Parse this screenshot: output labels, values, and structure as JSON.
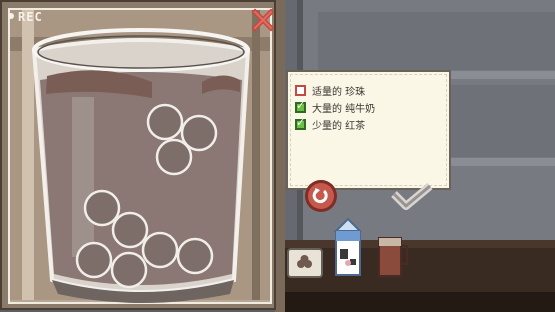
{
  "hud": {
    "rec_label": "REC"
  },
  "recipe": {
    "items": [
      {
        "text": "适量的 珍珠",
        "checked": false
      },
      {
        "text": "大量的 纯牛奶",
        "checked": true
      },
      {
        "text": "少量的 红茶",
        "checked": true
      }
    ]
  },
  "colors": {
    "accent_red": "#c14b42",
    "check_green": "#6bbf45",
    "tea_color": "#8b6f68",
    "pearl": "#7d6e6a"
  },
  "icons": {
    "close": "close-x-icon",
    "undo": "undo-icon",
    "confirm": "checkmark-icon",
    "pearls": "pearls-box-icon",
    "milk": "milk-carton-icon",
    "tea": "tea-pot-icon"
  }
}
